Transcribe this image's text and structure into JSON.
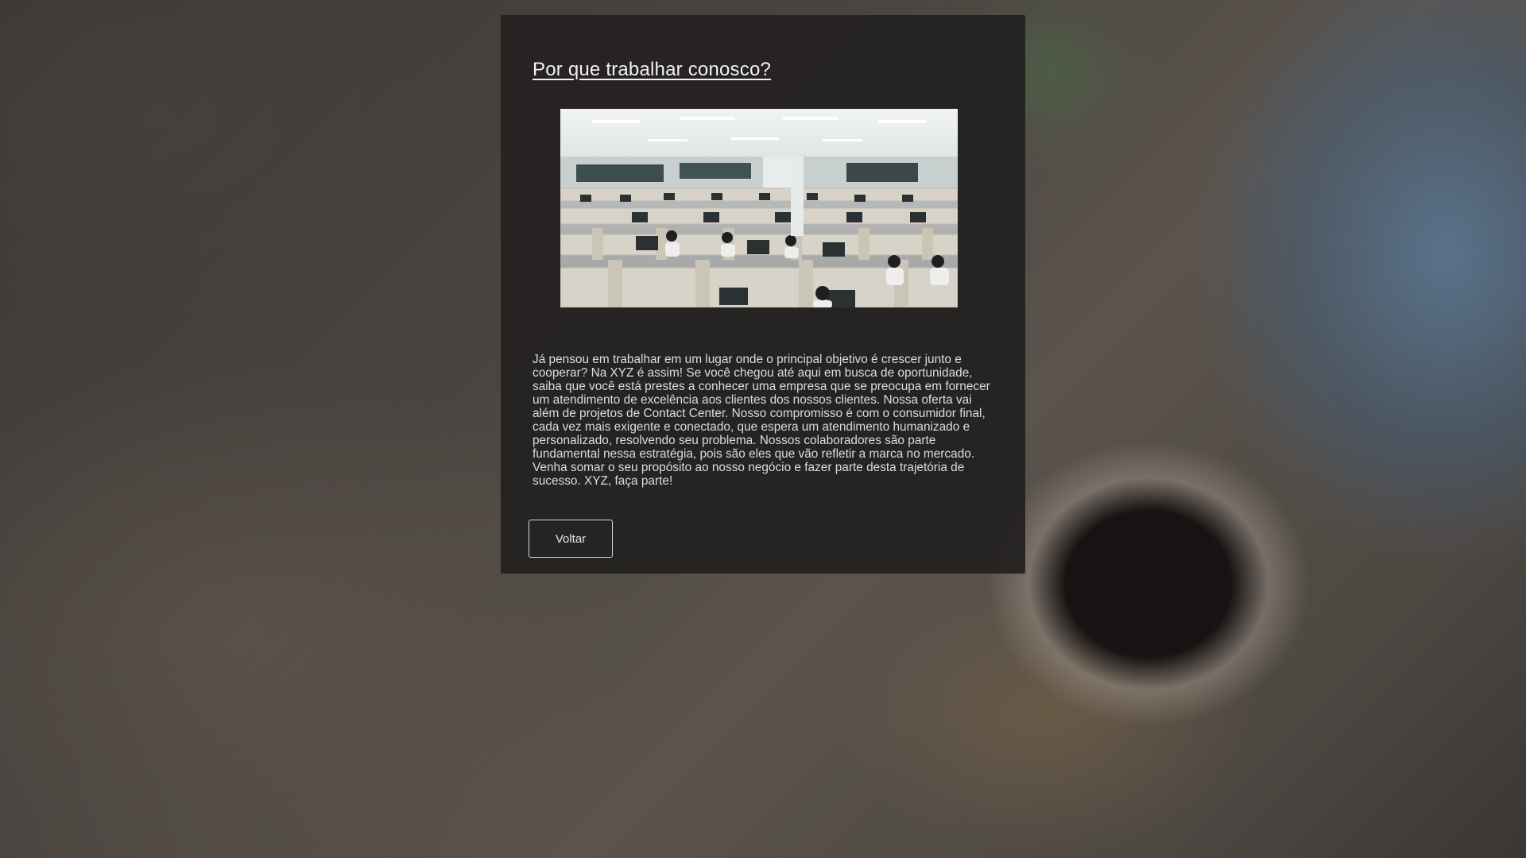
{
  "dialog": {
    "title": "Por que trabalhar conosco?",
    "body": "Já pensou em trabalhar em um lugar onde o principal objetivo é crescer junto e cooperar? Na XYZ é assim! Se você chegou até aqui em busca de oportunidade, saiba que você está prestes a conhecer uma empresa que se preocupa em fornecer um atendimento de excelência aos clientes dos nossos clientes. Nossa oferta vai além de projetos de Contact Center. Nosso compromisso é com o consumidor final, cada vez mais exigente e conectado, que espera um atendimento humanizado e personalizado, resolvendo seu problema. Nossos colaboradores são parte fundamental nessa estratégia, pois são eles que vão refletir a marca no mercado. Venha somar o seu propósito ao nosso negócio e fazer parte desta trajetória de sucesso. XYZ, faça parte!",
    "back_button_label": "Voltar"
  }
}
